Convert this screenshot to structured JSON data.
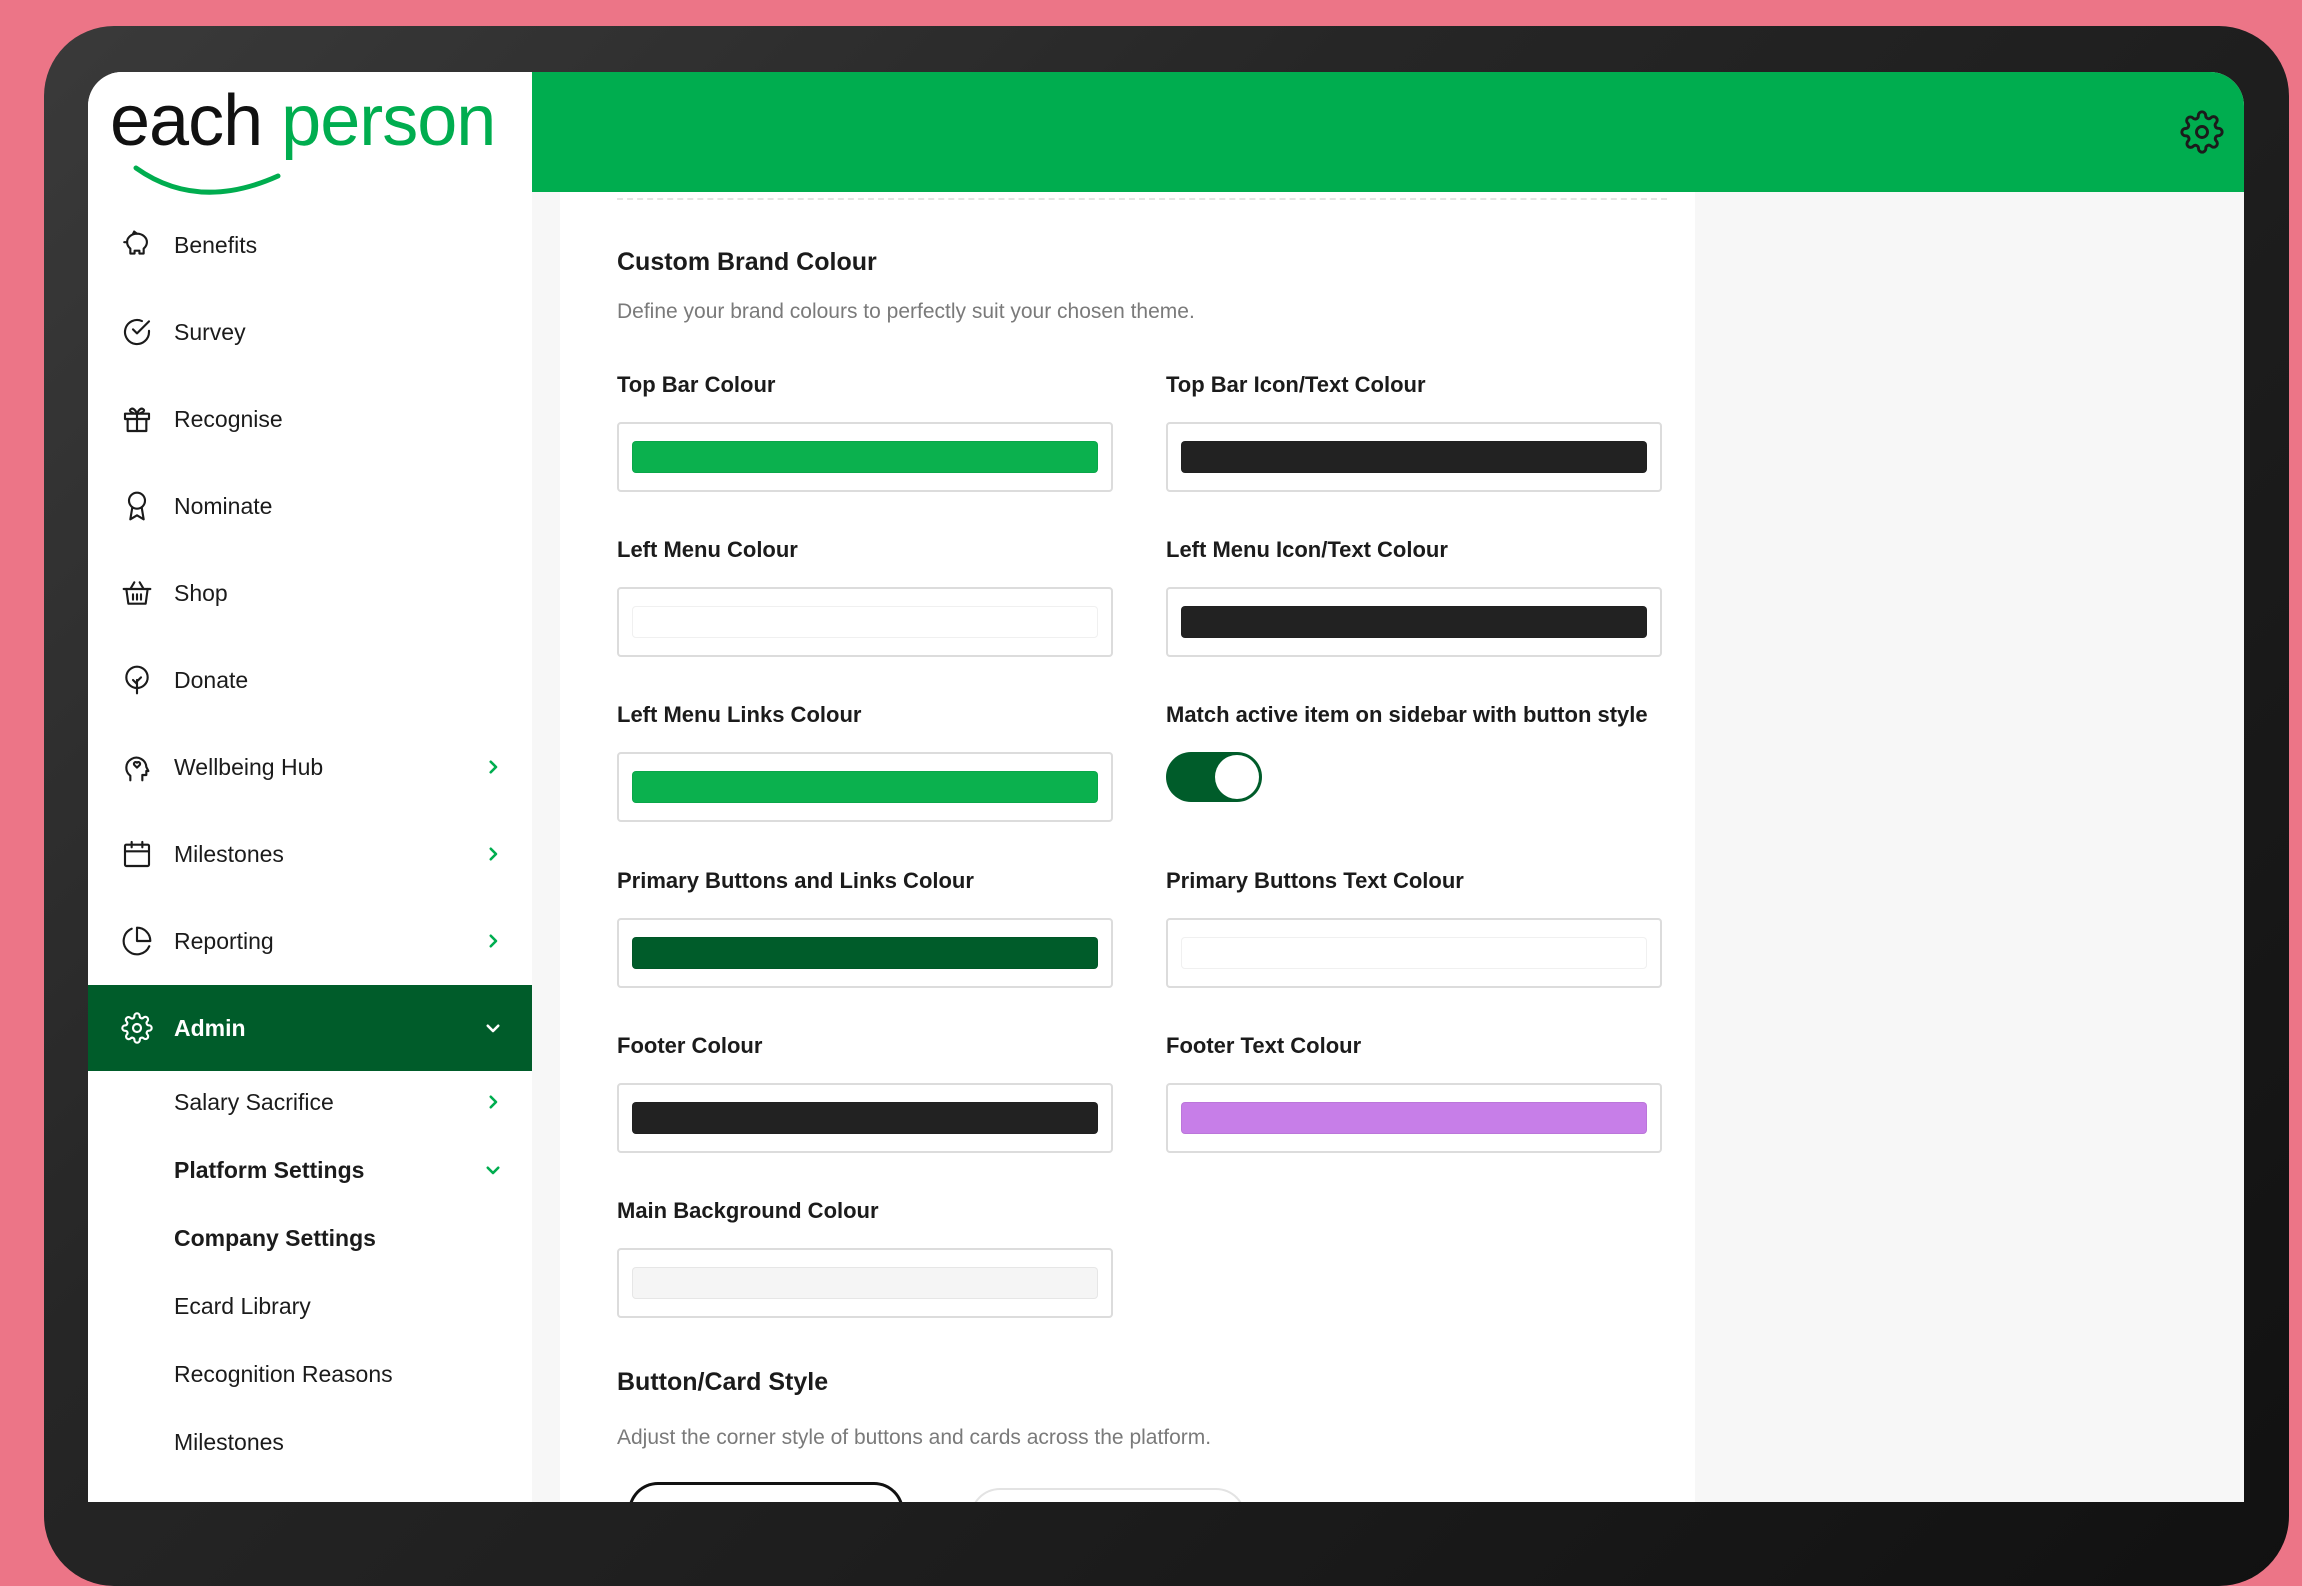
{
  "brand": {
    "logo_part1": "each",
    "logo_part2": "person",
    "accent": "#00ad4f",
    "dark_accent": "#005c2a"
  },
  "sidebar": {
    "items": [
      {
        "label": "Benefits",
        "icon": "piggy-bank-icon",
        "has_chevron": false
      },
      {
        "label": "Survey",
        "icon": "check-circle-icon",
        "has_chevron": false
      },
      {
        "label": "Recognise",
        "icon": "gift-icon",
        "has_chevron": false
      },
      {
        "label": "Nominate",
        "icon": "award-ribbon-icon",
        "has_chevron": false
      },
      {
        "label": "Shop",
        "icon": "basket-icon",
        "has_chevron": false
      },
      {
        "label": "Donate",
        "icon": "tree-icon",
        "has_chevron": false
      },
      {
        "label": "Wellbeing Hub",
        "icon": "head-heart-icon",
        "has_chevron": true
      },
      {
        "label": "Milestones",
        "icon": "calendar-icon",
        "has_chevron": true
      },
      {
        "label": "Reporting",
        "icon": "pie-chart-icon",
        "has_chevron": true
      },
      {
        "label": "Admin",
        "icon": "gear-icon",
        "has_chevron": true,
        "active": true
      }
    ],
    "sub_items": [
      {
        "label": "Salary Sacrifice",
        "bold": false,
        "chevron": "right"
      },
      {
        "label": "Platform Settings",
        "bold": true,
        "chevron": "down"
      },
      {
        "label": "Company Settings",
        "bold": true,
        "chevron": ""
      },
      {
        "label": "Ecard Library",
        "bold": false,
        "chevron": ""
      },
      {
        "label": "Recognition Reasons",
        "bold": false,
        "chevron": ""
      },
      {
        "label": "Milestones",
        "bold": false,
        "chevron": ""
      }
    ]
  },
  "topbar": {
    "settings_icon": "gear-icon"
  },
  "main": {
    "section1": {
      "title": "Custom Brand Colour",
      "description": "Define your brand colours to perfectly suit your chosen theme."
    },
    "fields": {
      "top_bar_colour": {
        "label": "Top Bar Colour",
        "value": "#0bb14e"
      },
      "top_bar_icon_text_colour": {
        "label": "Top Bar Icon/Text Colour",
        "value": "#222222"
      },
      "left_menu_colour": {
        "label": "Left Menu Colour",
        "value": "#ffffff"
      },
      "left_menu_icon_text_colour": {
        "label": "Left Menu Icon/Text Colour",
        "value": "#222222"
      },
      "left_menu_links_colour": {
        "label": "Left Menu Links Colour",
        "value": "#0bb14e"
      },
      "match_active_item": {
        "label": "Match active item on sidebar with button style",
        "on": true
      },
      "primary_buttons_links_colour": {
        "label": "Primary Buttons and Links Colour",
        "value": "#005c2a"
      },
      "primary_buttons_text_colour": {
        "label": "Primary Buttons Text Colour",
        "value": "#ffffff"
      },
      "footer_colour": {
        "label": "Footer Colour",
        "value": "#222222"
      },
      "footer_text_colour": {
        "label": "Footer Text Colour",
        "value": "#c77ee8"
      },
      "main_background_colour": {
        "label": "Main Background Colour",
        "value": "#f5f5f5"
      }
    },
    "section2": {
      "title": "Button/Card Style",
      "description": "Adjust the corner style of buttons and cards across the platform."
    }
  }
}
